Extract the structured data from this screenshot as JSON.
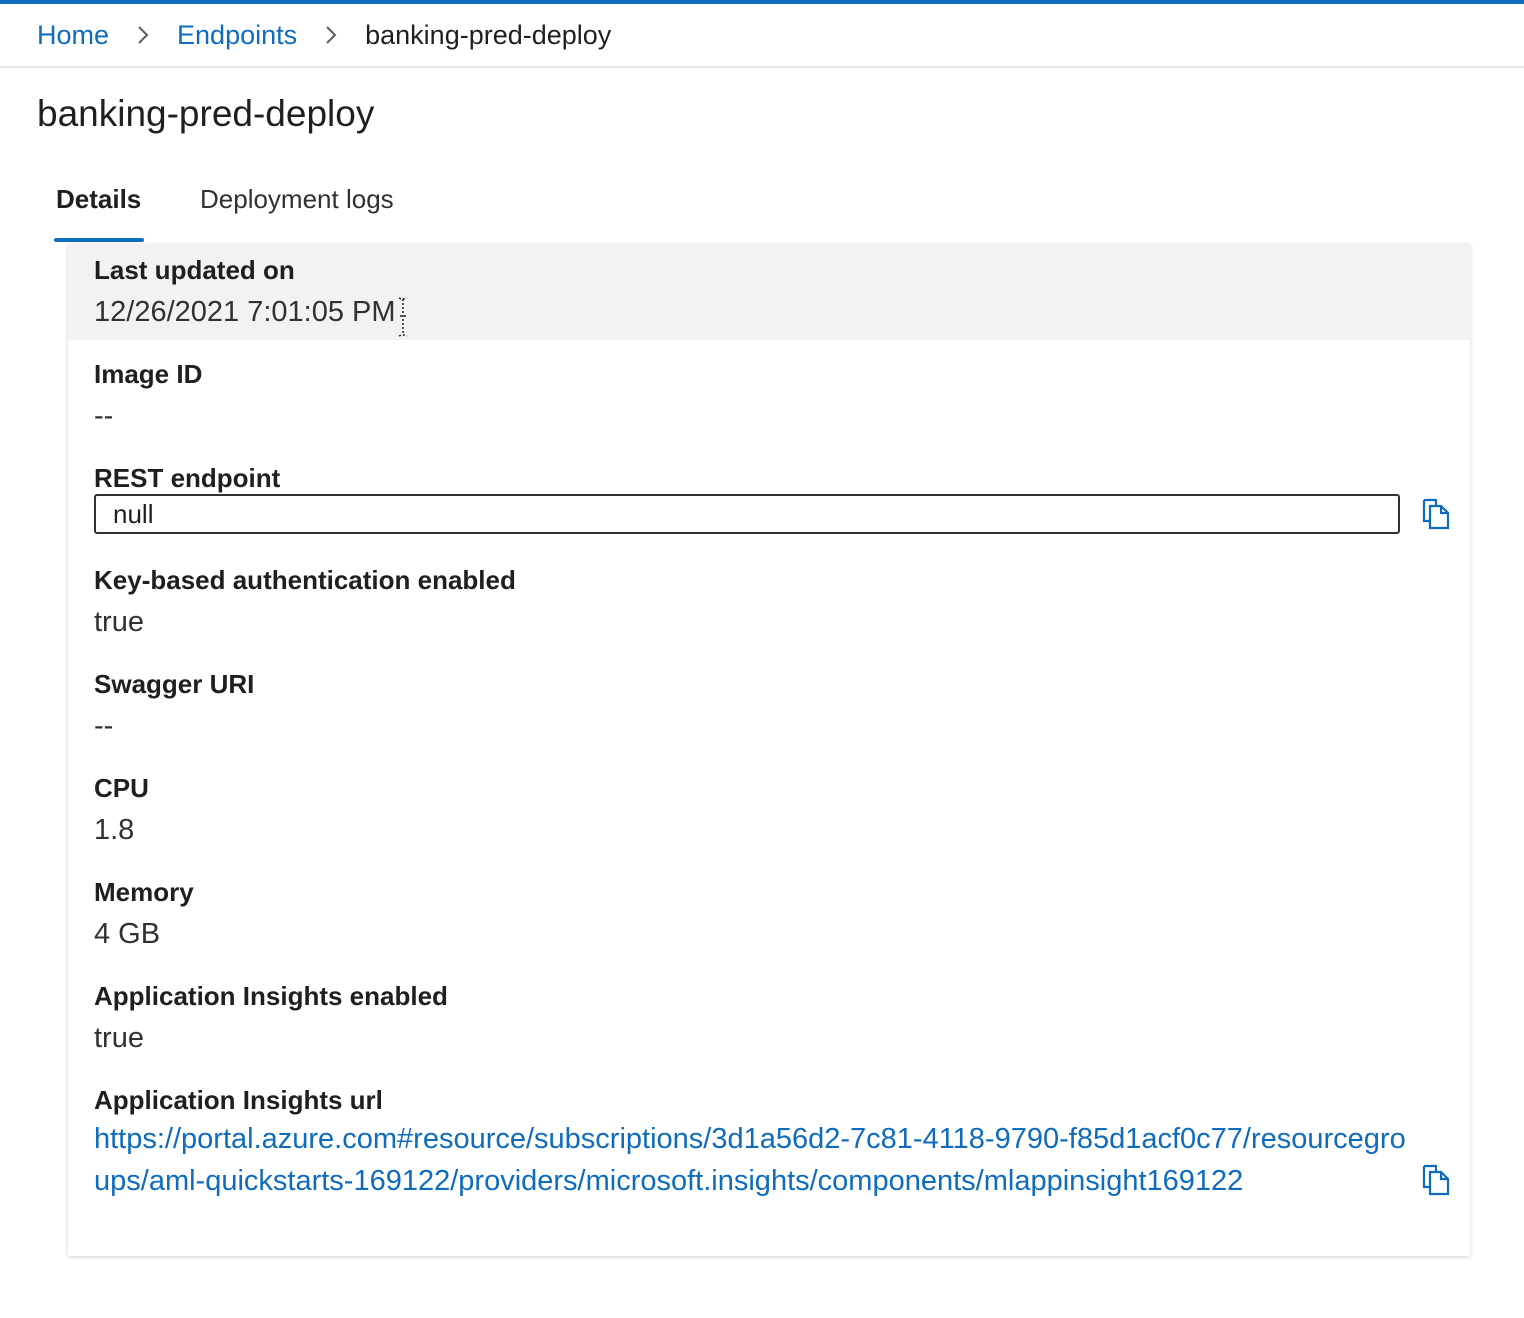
{
  "breadcrumb": {
    "home": "Home",
    "endpoints": "Endpoints",
    "current": "banking-pred-deploy"
  },
  "title": "banking-pred-deploy",
  "tabs": {
    "details": "Details",
    "logs": "Deployment logs"
  },
  "details": {
    "last_updated_label": "Last updated on",
    "last_updated_value": "12/26/2021 7:01:05 PM",
    "image_id_label": "Image ID",
    "image_id_value": "--",
    "rest_label": "REST endpoint",
    "rest_value": "null",
    "keyauth_label": "Key-based authentication enabled",
    "keyauth_value": "true",
    "swagger_label": "Swagger URI",
    "swagger_value": "--",
    "cpu_label": "CPU",
    "cpu_value": "1.8",
    "memory_label": "Memory",
    "memory_value": "4 GB",
    "appins_enabled_label": "Application Insights enabled",
    "appins_enabled_value": "true",
    "appins_url_label": "Application Insights url",
    "appins_url_value": "https://portal.azure.com#resource/subscriptions/3d1a56d2-7c81-4118-9790-f85d1acf0c77/resourcegroups/aml-quickstarts-169122/providers/microsoft.insights/components/mlappinsight169122"
  },
  "colors": {
    "accent": "#0f6cbd",
    "highlight_row": "#f3f2f1"
  },
  "icons": {
    "breadcrumb_separator": "chevron-right-icon",
    "copy": "copy-icon"
  }
}
